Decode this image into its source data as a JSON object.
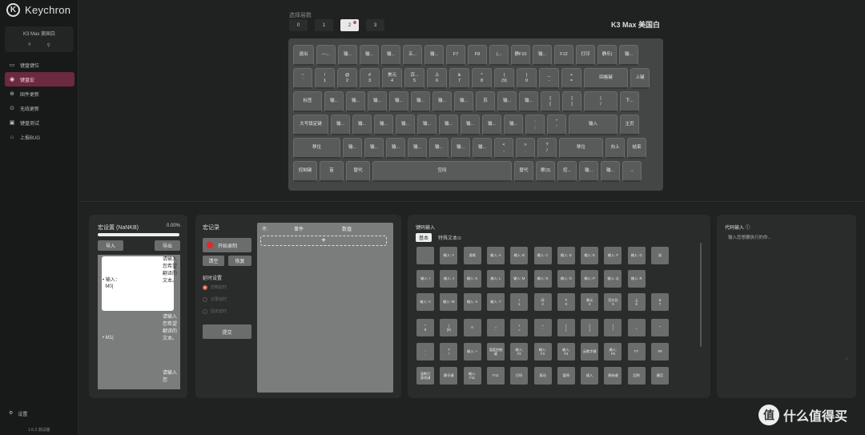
{
  "app": {
    "brand": "Keychron",
    "logo_glyph": "K"
  },
  "device": {
    "name": "K3 Max 美国白",
    "icon_left": "#",
    "icon_right": "⚲"
  },
  "nav": [
    {
      "label": "键盘键位",
      "icon": "keyboard-icon",
      "glyph": "▭",
      "active": false
    },
    {
      "label": "键盘宏",
      "icon": "macro-icon",
      "glyph": "◉",
      "active": true
    },
    {
      "label": "固件更新",
      "icon": "firmware-icon",
      "glyph": "⊕",
      "active": false
    },
    {
      "label": "无线更新",
      "icon": "wireless-icon",
      "glyph": "⊙",
      "active": false
    },
    {
      "label": "键盘测试",
      "icon": "test-icon",
      "glyph": "▣",
      "active": false
    },
    {
      "label": "上报BUG",
      "icon": "bug-icon",
      "glyph": "⌂",
      "active": false
    }
  ],
  "settings": {
    "label": "设置",
    "glyph": "⚙"
  },
  "version": "1.6.3 测试版",
  "layers": {
    "label": "选择层数",
    "items": [
      "0",
      "1",
      "2",
      "3"
    ],
    "active": 2
  },
  "model": "K3 Max 美国白",
  "keyboard": {
    "rows": [
      [
        {
          "l": "退出",
          "w": 26
        },
        {
          "l": "—...",
          "w": 24
        },
        {
          "l": "输...",
          "w": 24
        },
        {
          "l": "输...",
          "w": 24
        },
        {
          "l": "输...",
          "w": 24
        },
        {
          "l": "五...",
          "w": 24
        },
        {
          "l": "输...",
          "w": 24
        },
        {
          "l": "F7",
          "w": 24
        },
        {
          "l": "F8",
          "w": 24
        },
        {
          "l": "(...",
          "w": 24
        },
        {
          "l": "静F10",
          "w": 24
        },
        {
          "l": "输...",
          "w": 24
        },
        {
          "l": "F12",
          "w": 24
        },
        {
          "l": "打印",
          "w": 24
        },
        {
          "l": "静乐(",
          "w": 24
        },
        {
          "l": "输...",
          "w": 24
        }
      ],
      [
        {
          "l": "~\n`",
          "w": 24
        },
        {
          "l": "!\n1",
          "w": 25
        },
        {
          "l": "@\n2",
          "w": 25
        },
        {
          "l": "#\n3",
          "w": 25
        },
        {
          "l": "美元\n4",
          "w": 25
        },
        {
          "l": "百...\n5",
          "w": 25
        },
        {
          "l": "上\n6",
          "w": 25
        },
        {
          "l": "&\n7",
          "w": 25
        },
        {
          "l": "*\n8",
          "w": 25
        },
        {
          "l": "(\n(9)",
          "w": 25
        },
        {
          "l": ")\n0",
          "w": 25
        },
        {
          "l": "_\n-",
          "w": 25
        },
        {
          "l": "+\n=",
          "w": 25
        },
        {
          "l": "回格键",
          "w": 55
        },
        {
          "l": "上键",
          "w": 24
        }
      ],
      [
        {
          "l": "标签",
          "w": 36
        },
        {
          "l": "输...",
          "w": 24
        },
        {
          "l": "输...",
          "w": 24
        },
        {
          "l": "输...",
          "w": 24
        },
        {
          "l": "输...",
          "w": 24
        },
        {
          "l": "输...",
          "w": 24
        },
        {
          "l": "输...",
          "w": 24
        },
        {
          "l": "输...",
          "w": 24
        },
        {
          "l": "苏",
          "w": 24
        },
        {
          "l": "输...",
          "w": 24
        },
        {
          "l": "输...",
          "w": 24
        },
        {
          "l": "{\n[",
          "w": 24
        },
        {
          "l": "}\n]",
          "w": 24
        },
        {
          "l": "|\n/",
          "w": 42
        },
        {
          "l": "下...",
          "w": 24
        }
      ],
      [
        {
          "l": "大写锁定键",
          "w": 44
        },
        {
          "l": "输...",
          "w": 24
        },
        {
          "l": "输...",
          "w": 24
        },
        {
          "l": "输...",
          "w": 24
        },
        {
          "l": "输...",
          "w": 24
        },
        {
          "l": "输...",
          "w": 24
        },
        {
          "l": "输...",
          "w": 24
        },
        {
          "l": "输...",
          "w": 24
        },
        {
          "l": "输...",
          "w": 24
        },
        {
          "l": "输...",
          "w": 24
        },
        {
          "l": ":\n;",
          "w": 24
        },
        {
          "l": "\"\n'",
          "w": 24
        },
        {
          "l": "输入",
          "w": 61
        },
        {
          "l": "主页",
          "w": 24
        }
      ],
      [
        {
          "l": "移位",
          "w": 59
        },
        {
          "l": "输...",
          "w": 24
        },
        {
          "l": "输...",
          "w": 24
        },
        {
          "l": "输...",
          "w": 24
        },
        {
          "l": "输...",
          "w": 24
        },
        {
          "l": "输...",
          "w": 24
        },
        {
          "l": "输...",
          "w": 24
        },
        {
          "l": "输...",
          "w": 24
        },
        {
          "l": "<\n,",
          "w": 24
        },
        {
          "l": ">\n.",
          "w": 24
        },
        {
          "l": "?\n/",
          "w": 24
        },
        {
          "l": "移位",
          "w": 55
        },
        {
          "l": "向上",
          "w": 24
        },
        {
          "l": "结束",
          "w": 24
        }
      ],
      [
        {
          "l": "控制键",
          "w": 30
        },
        {
          "l": "苗",
          "w": 30
        },
        {
          "l": "替代",
          "w": 30
        },
        {
          "l": "空间",
          "w": 174
        },
        {
          "l": "替代",
          "w": 24
        },
        {
          "l": "摩(3)",
          "w": 24
        },
        {
          "l": "控...",
          "w": 24
        },
        {
          "l": "输...",
          "w": 24
        },
        {
          "l": "输...",
          "w": 24
        },
        {
          "l": "→",
          "w": 24
        }
      ]
    ]
  },
  "macro_settings": {
    "title": "宏设置 (NaNKB)",
    "percent": "0.00%",
    "import_label": "导入",
    "export_label": "导出",
    "items": [
      {
        "label": "• 输入：\n  M0|",
        "tip": "请输入您希望翻译的文本。"
      },
      {
        "label": "• M1|",
        "tip": "请输入您希望翻译的文本。"
      },
      {
        "label": "",
        "tip": "请输入您"
      }
    ]
  },
  "macro_record": {
    "title": "宏记录",
    "record_label": "开始录制",
    "clear_label": "清空",
    "restore_label": "恢复",
    "delay_title": "延时设置",
    "delay_options": [
      "忽略延时",
      "记录延时",
      "固定延时"
    ],
    "submit_label": "提交",
    "columns": [
      "不.",
      "事件",
      "数值"
    ],
    "add": "+"
  },
  "keycode_input": {
    "title": "键码输入",
    "tabs": [
      "基本",
      "特殊文本⊙"
    ],
    "keys": [
      [
        "",
        "输入: Y",
        "退格",
        "输入: A",
        "输入: B",
        "输入: C",
        "输入: D",
        "输入: E",
        "输入: F",
        "输入: G",
        "退"
      ],
      [
        "输入: I",
        "输入: J",
        "输入: K",
        "输入: L",
        "输入: M",
        "输入: N",
        "输入: O",
        "输入: P",
        "输入: Q",
        "输入: R"
      ],
      [
        "输入: V",
        "输入: W",
        "输入: X",
        "输入: Y",
        "!\n1",
        "@\n2",
        "#\n3",
        "美元\n4",
        "百分比\n5",
        "上\n6",
        "&\n7"
      ],
      [
        "*\n8",
        "(\n(9)",
        "0",
        "_\n-",
        "+\n=",
        "~\n`",
        "{\n[",
        "}\n]",
        "|\n/",
        "_",
        "\""
      ],
      [
        ",\n,",
        "?\n/",
        "输入: +",
        "温度控制\n键",
        "输入:\nF2",
        "输入:\nF3",
        "输入:\nF4",
        "云数字键",
        "输入:\nF6",
        "F7",
        "F8"
      ],
      [
        "温数打\n游戏键",
        "静乐键",
        "输入:\nF11",
        "F12",
        "打印",
        "滚动",
        "暂停",
        "插入",
        "原始键",
        "回到",
        "最后",
        "主页"
      ]
    ]
  },
  "code_input": {
    "title": "代码输入 ⓘ",
    "placeholder": "输入您想要执行的命...",
    "resize": "⌟"
  },
  "watermark": {
    "glyph": "值",
    "text": "什么值得买"
  }
}
